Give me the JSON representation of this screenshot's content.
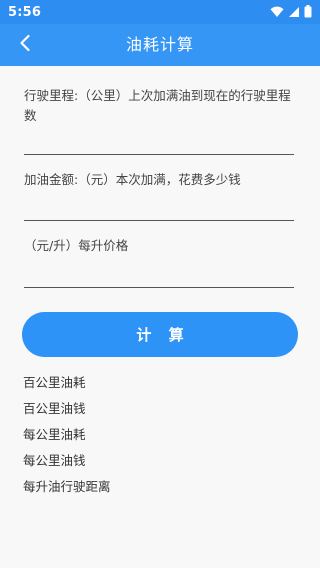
{
  "status_bar": {
    "time": "5:56",
    "icons": [
      "wifi-icon",
      "signal-icon",
      "battery-icon"
    ]
  },
  "app_bar": {
    "back_icon": "chevron-left-icon",
    "title": "油耗计算"
  },
  "form": {
    "mileage_label": "行驶里程:（公里）上次加满油到现在的行驶里程数",
    "mileage_value": "",
    "amount_label": "加油金额:（元）本次加满，花费多少钱",
    "amount_value": "",
    "price_label": "（元/升）每升价格",
    "price_value": ""
  },
  "calculate_button": "计 算",
  "results": [
    "百公里油耗",
    "百公里油钱",
    "每公里油耗",
    "每公里油钱",
    "每升油行驶距离"
  ],
  "colors": {
    "primary": "#3596f6",
    "status_bar": "#2d8df0",
    "button": "#2d93f7",
    "background": "#f8f8f8"
  }
}
